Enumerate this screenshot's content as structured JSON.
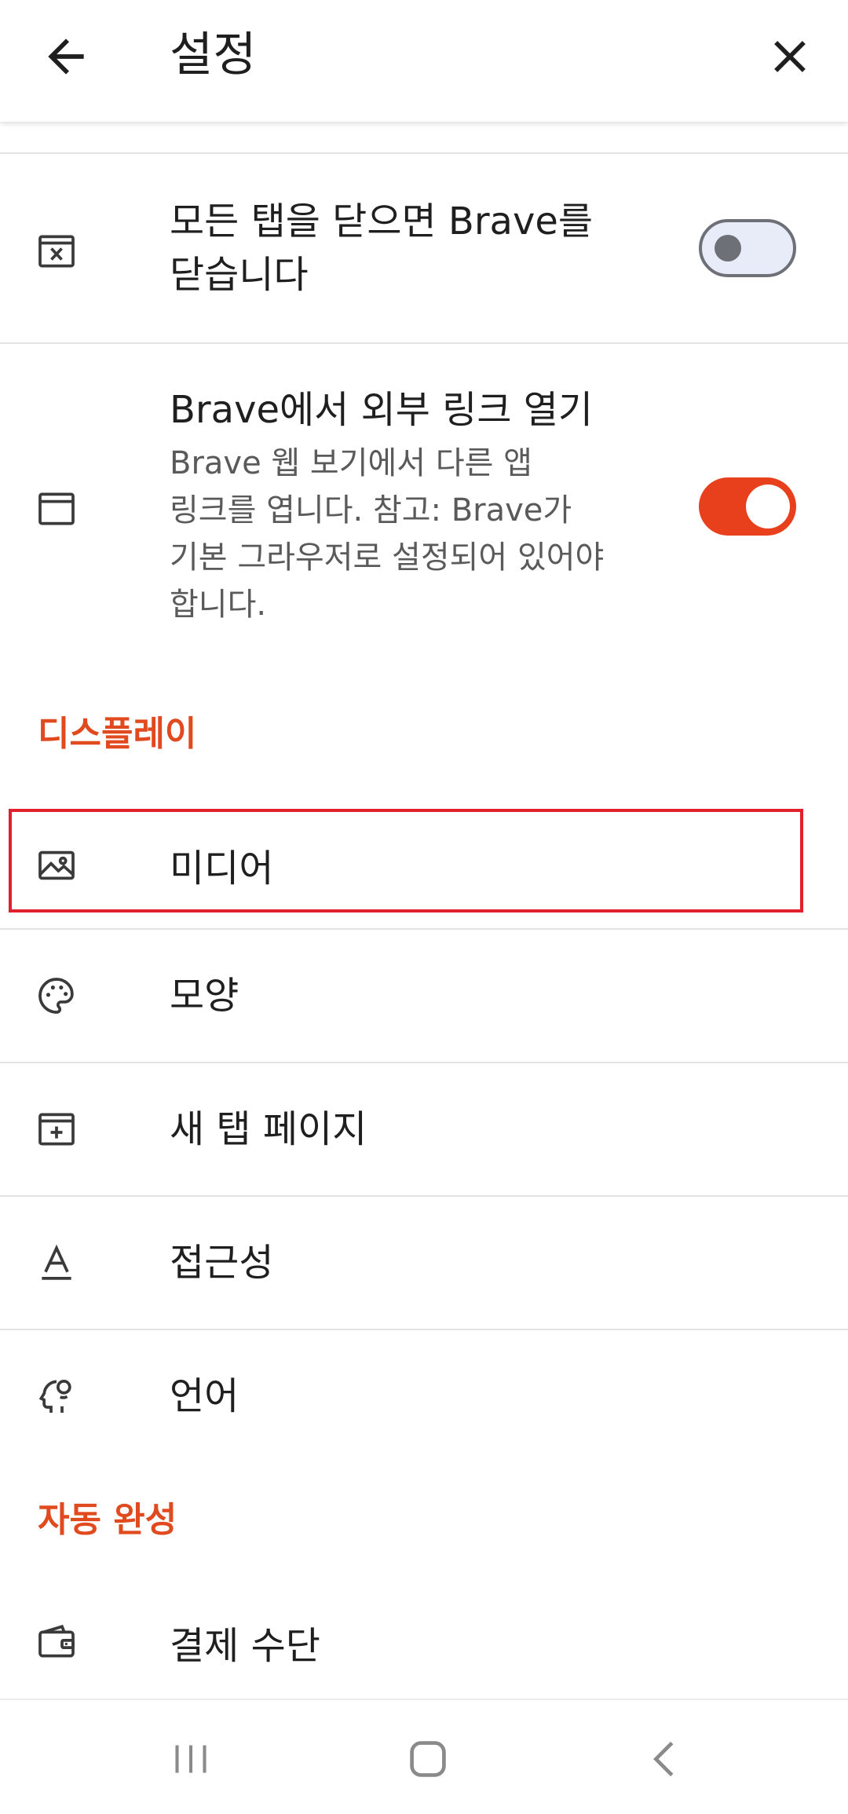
{
  "app_bar": {
    "title": "설정",
    "back_icon": "arrow-left-icon",
    "close_icon": "close-icon"
  },
  "settings": {
    "close_tabs": {
      "label_line1": "모든 탭을 닫으면 Brave를",
      "label_line2": "닫습니다",
      "icon": "close-window-icon",
      "toggle_on": false
    },
    "external_links": {
      "label": "Brave에서 외부 링크 열기",
      "desc_line1": "Brave 웹 보기에서 다른 앱",
      "desc_line2": "링크를 엽니다. 참고: Brave가",
      "desc_line3": "기본 그라우저로 설정되어 있어야",
      "desc_line4": "합니다.",
      "icon": "browser-window-icon",
      "toggle_on": true
    }
  },
  "display_section": {
    "header": "디스플레이",
    "items": [
      {
        "label": "미디어",
        "icon": "image-icon"
      },
      {
        "label": "모양",
        "icon": "palette-icon"
      },
      {
        "label": "새 탭 페이지",
        "icon": "new-tab-icon"
      },
      {
        "label": "접근성",
        "icon": "text-accessibility-icon"
      },
      {
        "label": "언어",
        "icon": "language-head-icon"
      }
    ]
  },
  "autofill_section": {
    "header": "자동 완성",
    "items": [
      {
        "label": "결제 수단",
        "icon": "wallet-icon"
      }
    ]
  },
  "nav_bar": {
    "recents_icon": "recents-icon",
    "home_icon": "home-icon",
    "back_icon": "nav-back-icon"
  },
  "colors": {
    "accent": "#e14a1f",
    "toggle_on": "#e8401c",
    "highlight": "#e0202a"
  }
}
